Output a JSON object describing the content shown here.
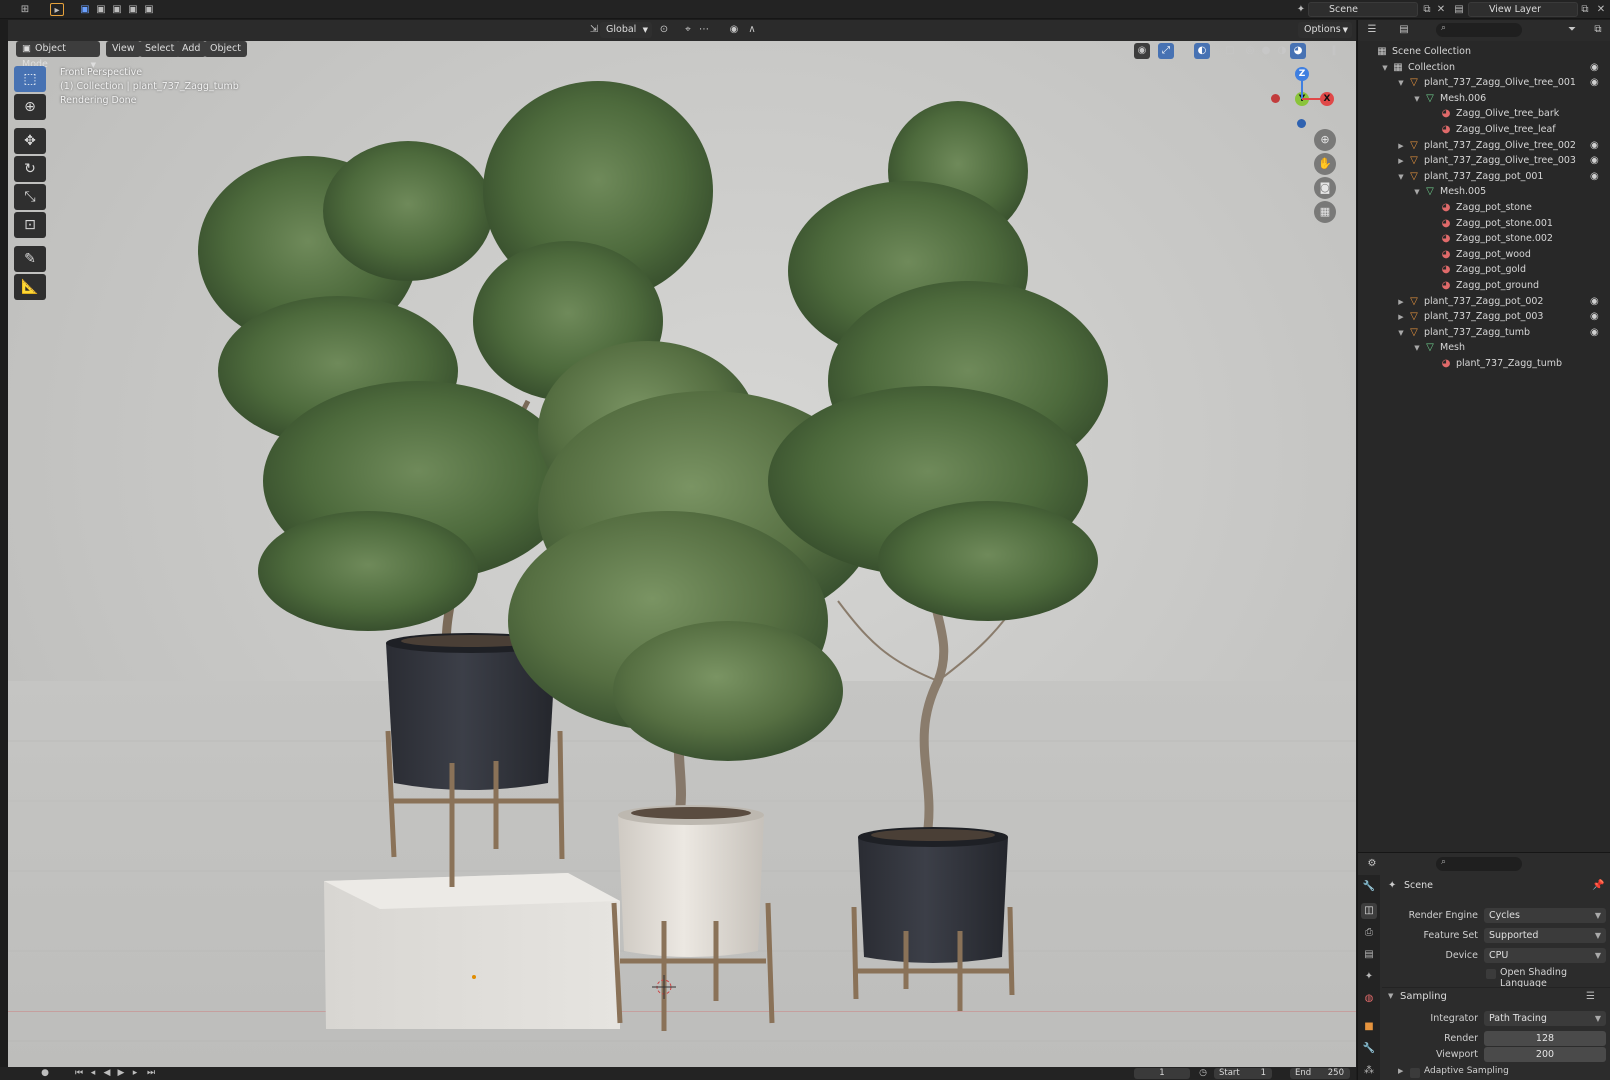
{
  "topbar": {
    "scene_label": "Scene",
    "view_layer_label": "View Layer"
  },
  "viewport_header": {
    "mode": "Object Mode",
    "menus": [
      "View",
      "Select",
      "Add",
      "Object"
    ],
    "orientation": "Global",
    "options_label": "Options"
  },
  "viewport": {
    "perspective": "Front Perspective",
    "collection_info": "(1) Collection | plant_737_Zagg_tumb",
    "status": "Rendering Done",
    "gizmo": {
      "z": "Z",
      "y": "Y",
      "x": "X"
    }
  },
  "outliner": {
    "rows": [
      {
        "label": "Scene Collection",
        "depth": 0,
        "icon": "collection",
        "expanded": null,
        "eye": false
      },
      {
        "label": "Collection",
        "depth": 1,
        "icon": "collection",
        "expanded": true,
        "eye": true
      },
      {
        "label": "plant_737_Zagg_Olive_tree_001",
        "depth": 2,
        "icon": "object",
        "expanded": true,
        "eye": true
      },
      {
        "label": "Mesh.006",
        "depth": 3,
        "icon": "mesh",
        "expanded": true,
        "eye": false
      },
      {
        "label": "Zagg_Olive_tree_bark",
        "depth": 4,
        "icon": "material",
        "expanded": null,
        "eye": false
      },
      {
        "label": "Zagg_Olive_tree_leaf",
        "depth": 4,
        "icon": "material",
        "expanded": null,
        "eye": false
      },
      {
        "label": "plant_737_Zagg_Olive_tree_002",
        "depth": 2,
        "icon": "object",
        "expanded": false,
        "eye": true
      },
      {
        "label": "plant_737_Zagg_Olive_tree_003",
        "depth": 2,
        "icon": "object",
        "expanded": false,
        "eye": true
      },
      {
        "label": "plant_737_Zagg_pot_001",
        "depth": 2,
        "icon": "object",
        "expanded": true,
        "eye": true
      },
      {
        "label": "Mesh.005",
        "depth": 3,
        "icon": "mesh",
        "expanded": true,
        "eye": false
      },
      {
        "label": "Zagg_pot_stone",
        "depth": 4,
        "icon": "material",
        "expanded": null,
        "eye": false
      },
      {
        "label": "Zagg_pot_stone.001",
        "depth": 4,
        "icon": "material",
        "expanded": null,
        "eye": false
      },
      {
        "label": "Zagg_pot_stone.002",
        "depth": 4,
        "icon": "material",
        "expanded": null,
        "eye": false
      },
      {
        "label": "Zagg_pot_wood",
        "depth": 4,
        "icon": "material",
        "expanded": null,
        "eye": false
      },
      {
        "label": "Zagg_pot_gold",
        "depth": 4,
        "icon": "material",
        "expanded": null,
        "eye": false
      },
      {
        "label": "Zagg_pot_ground",
        "depth": 4,
        "icon": "material",
        "expanded": null,
        "eye": false
      },
      {
        "label": "plant_737_Zagg_pot_002",
        "depth": 2,
        "icon": "object",
        "expanded": false,
        "eye": true
      },
      {
        "label": "plant_737_Zagg_pot_003",
        "depth": 2,
        "icon": "object",
        "expanded": false,
        "eye": true
      },
      {
        "label": "plant_737_Zagg_tumb",
        "depth": 2,
        "icon": "object",
        "expanded": true,
        "eye": true
      },
      {
        "label": "Mesh",
        "depth": 3,
        "icon": "mesh",
        "expanded": true,
        "eye": false
      },
      {
        "label": "plant_737_Zagg_tumb",
        "depth": 4,
        "icon": "material",
        "expanded": null,
        "eye": false
      }
    ]
  },
  "properties": {
    "context": "Scene",
    "render_engine_label": "Render Engine",
    "render_engine": "Cycles",
    "feature_set_label": "Feature Set",
    "feature_set": "Supported",
    "device_label": "Device",
    "device": "CPU",
    "osl_label": "Open Shading Language",
    "sampling_label": "Sampling",
    "integrator_label": "Integrator",
    "integrator": "Path Tracing",
    "render_label": "Render",
    "render_samples": "128",
    "viewport_label": "Viewport",
    "viewport_samples": "200",
    "adaptive_label": "Adaptive Sampling"
  },
  "timeline": {
    "current_frame": "1",
    "start_label": "Start",
    "start": "1",
    "end_label": "End",
    "end": "250"
  },
  "colors": {
    "accent": "#4772b3",
    "object_icon": "#e6943e",
    "mesh_icon": "#6fcf8e",
    "material_icon": "#e06a6a",
    "axis_x": "#e04848",
    "axis_y": "#8ac43a",
    "axis_z": "#3f7fe0"
  }
}
